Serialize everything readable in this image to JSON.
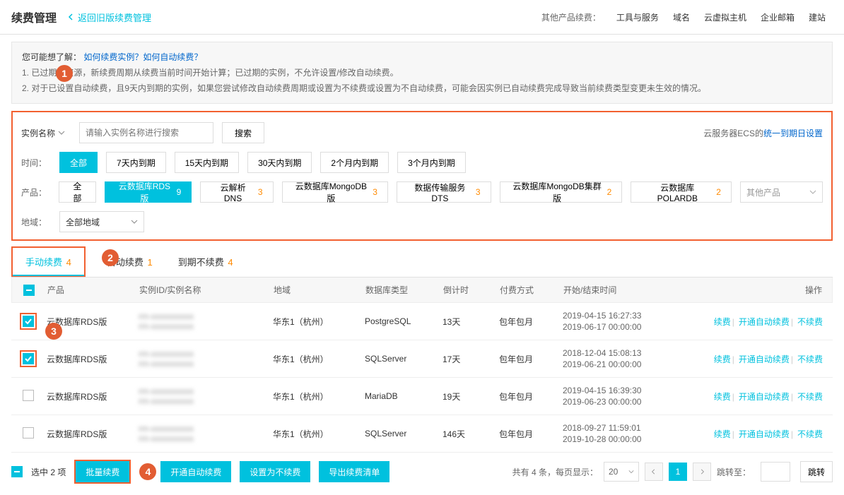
{
  "header": {
    "title": "续费管理",
    "back": "返回旧版续费管理",
    "other_label": "其他产品续费：",
    "links": [
      "工具与服务",
      "域名",
      "云虚拟主机",
      "企业邮箱",
      "建站"
    ]
  },
  "info": {
    "q_prefix": "您可能想了解：",
    "q_link": "如何续费实例？如何自动续费？",
    "l1": "1. 已过期的资源，新续费周期从续费当前时间开始计算；已过期的实例，不允许设置/修改自动续费。",
    "l2": "2. 对于已设置自动续费，且9天内到期的实例，如果您尝试修改自动续费周期或设置为不续费或设置为不自动续费，可能会因实例已自动续费完成导致当前续费类型变更未生效的情况。"
  },
  "filter": {
    "name_label": "实例名称",
    "placeholder": "请输入实例名称进行搜索",
    "search_btn": "搜索",
    "ecs_text": "云服务器ECS的",
    "ecs_link": "统一到期日设置",
    "time_label": "时间：",
    "time_opts": [
      "全部",
      "7天内到期",
      "15天内到期",
      "30天内到期",
      "2个月内到期",
      "3个月内到期"
    ],
    "prod_label": "产品：",
    "prod_opts": [
      {
        "label": "全部",
        "count": ""
      },
      {
        "label": "云数据库RDS版",
        "count": "9",
        "active": true
      },
      {
        "label": "云解析 DNS",
        "count": "3"
      },
      {
        "label": "云数据库MongoDB版",
        "count": "3"
      },
      {
        "label": "数据传输服务DTS",
        "count": "3"
      },
      {
        "label": "云数据库MongoDB集群版",
        "count": "2"
      },
      {
        "label": "云数据库POLARDB",
        "count": "2"
      }
    ],
    "other_prod": "其他产品",
    "region_label": "地域：",
    "region_value": "全部地域"
  },
  "tabs": [
    {
      "label": "手动续费",
      "count": "4",
      "active": true
    },
    {
      "label": "自动续费",
      "count": "1"
    },
    {
      "label": "到期不续费",
      "count": "4"
    }
  ],
  "thead": {
    "prod": "产品",
    "id": "实例ID/实例名称",
    "region": "地域",
    "db": "数据库类型",
    "count": "倒计时",
    "pay": "付费方式",
    "time": "开始/结束时间",
    "ops": "操作"
  },
  "rows": [
    {
      "checked": true,
      "prod": "云数据库RDS版",
      "id": "rm-xxxxxxxxxx",
      "region": "华东1（杭州）",
      "db": "PostgreSQL",
      "count": "13天",
      "pay": "包年包月",
      "t1": "2019-04-15 16:27:33",
      "t2": "2019-06-17 00:00:00"
    },
    {
      "checked": true,
      "prod": "云数据库RDS版",
      "id": "rm-xxxxxxxxxx",
      "region": "华东1（杭州）",
      "db": "SQLServer",
      "count": "17天",
      "pay": "包年包月",
      "t1": "2018-12-04 15:08:13",
      "t2": "2019-06-21 00:00:00"
    },
    {
      "checked": false,
      "prod": "云数据库RDS版",
      "id": "rm-xxxxxxxxxx",
      "region": "华东1（杭州）",
      "db": "MariaDB",
      "count": "19天",
      "pay": "包年包月",
      "t1": "2019-04-15 16:39:30",
      "t2": "2019-06-23 00:00:00"
    },
    {
      "checked": false,
      "prod": "云数据库RDS版",
      "id": "rm-xxxxxxxxxx",
      "region": "华东1（杭州）",
      "db": "SQLServer",
      "count": "146天",
      "pay": "包年包月",
      "t1": "2018-09-27 11:59:01",
      "t2": "2019-10-28 00:00:00"
    }
  ],
  "ops": {
    "renew": "续费",
    "auto": "开通自动续费",
    "no": "不续费"
  },
  "footer": {
    "sel_text": "选中 2 项",
    "batch": "批量续费",
    "auto": "开通自动续费",
    "set_no": "设置为不续费",
    "export": "导出续费清单",
    "total": "共有 4 条，每页显示：",
    "pagesize": "20",
    "page": "1",
    "jump_label": "跳转至：",
    "jump_btn": "跳转"
  },
  "steps": {
    "s1": "1",
    "s2": "2",
    "s3": "3",
    "s4": "4"
  }
}
